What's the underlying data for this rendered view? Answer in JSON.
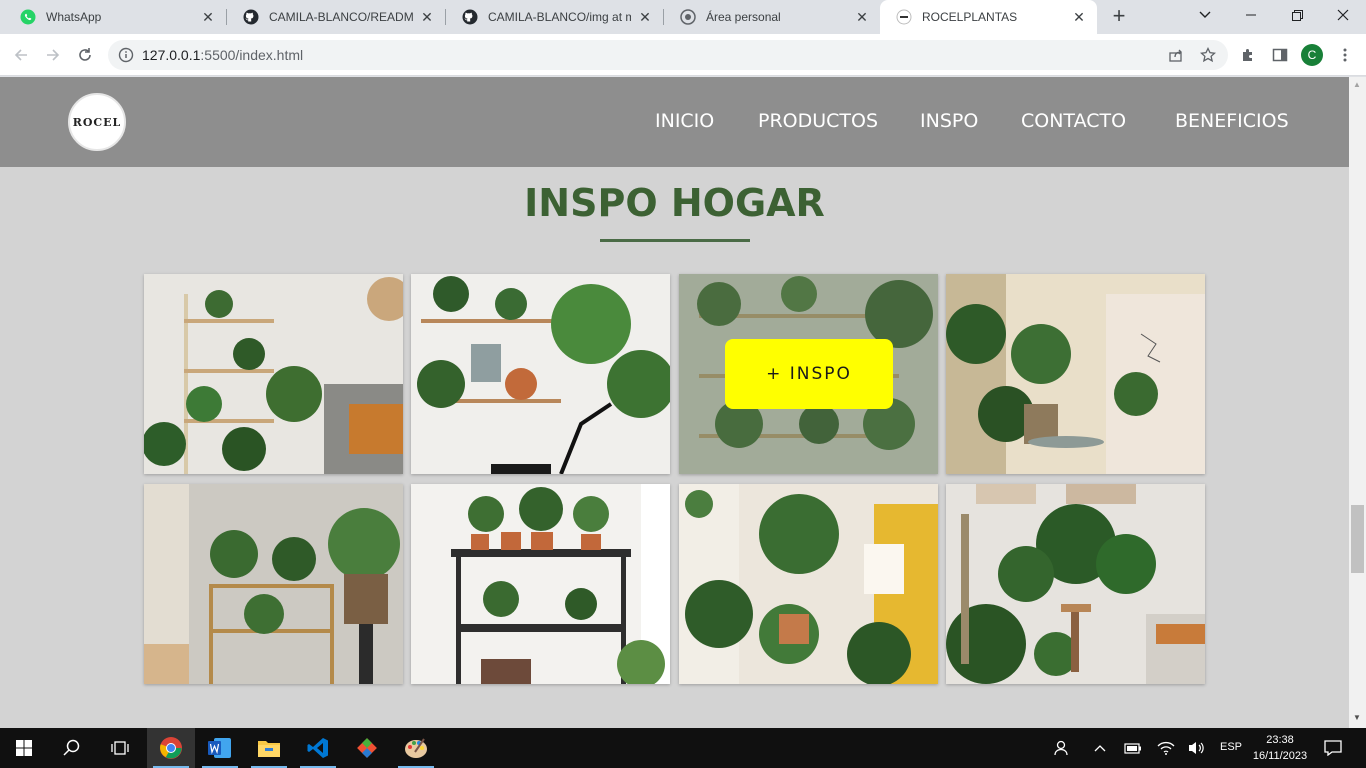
{
  "browser": {
    "tabs": [
      {
        "title": "WhatsApp",
        "icon": "whatsapp-icon",
        "active": false
      },
      {
        "title": "CAMILA-BLANCO/README.md",
        "icon": "github-icon",
        "active": false
      },
      {
        "title": "CAMILA-BLANCO/img at main",
        "icon": "github-icon",
        "active": false
      },
      {
        "title": "Área personal",
        "icon": "moodle-icon",
        "active": false
      },
      {
        "title": "ROCELPLANTAS",
        "icon": "rocel-favicon",
        "active": true
      }
    ],
    "url_host": "127.0.0.1",
    "url_path": ":5500/index.html",
    "profile_initial": "C"
  },
  "site": {
    "logo_text": "ROCEL",
    "nav": [
      "INICIO",
      "PRODUCTOS",
      "INSPO",
      "CONTACTO",
      "BENEFICIOS"
    ],
    "section_title": "INSPO HOGAR",
    "hover_button": "+ INSPO",
    "accent_color": "#3c6133",
    "button_color": "#ffff00"
  },
  "taskbar": {
    "language": "ESP",
    "time": "23:38",
    "date": "16/11/2023"
  }
}
